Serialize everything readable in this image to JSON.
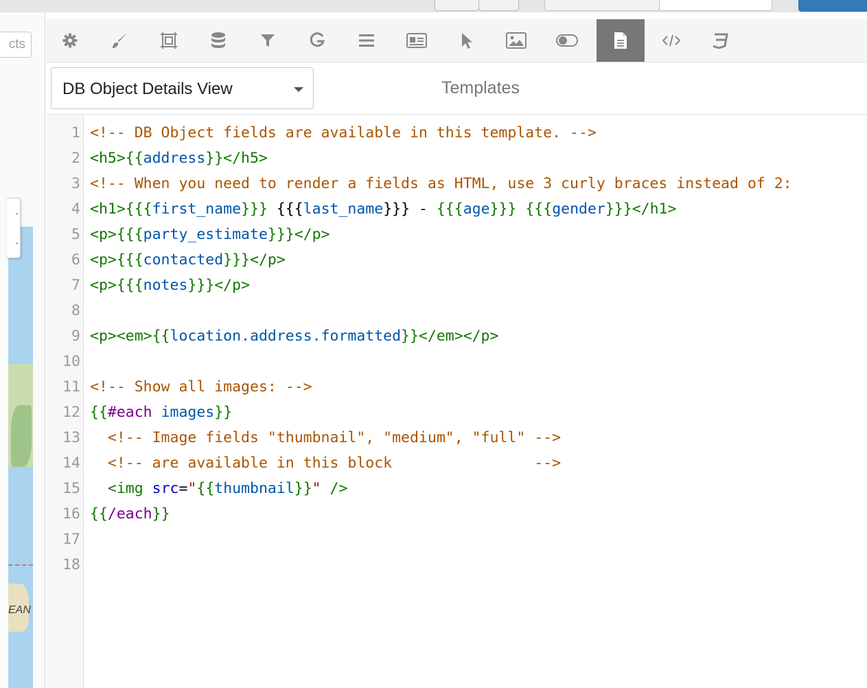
{
  "left_panel": {
    "objects_button_label": "cts",
    "map_ocean_label": "EAN",
    "zoom_in": "-",
    "zoom_out": "-"
  },
  "toolbar": {
    "icons": [
      "gear-icon",
      "brush-icon",
      "layout-icon",
      "database-icon",
      "filter-icon",
      "g-icon",
      "bars-icon",
      "card-icon",
      "cursor-icon",
      "image-icon",
      "toggle-icon",
      "template-icon",
      "code-icon",
      "css3-icon"
    ],
    "active": "template-icon"
  },
  "header": {
    "view_select_value": "DB Object Details View",
    "title": "Templates"
  },
  "editor": {
    "lines": [
      {
        "n": "1",
        "tokens": [
          {
            "t": "comment",
            "v": "<!-- DB Object fields are available in this template. -->"
          }
        ]
      },
      {
        "n": "2",
        "tokens": [
          {
            "t": "tag",
            "v": "<h5>{{"
          },
          {
            "t": "var",
            "v": "address"
          },
          {
            "t": "tag",
            "v": "}}</h5>"
          }
        ]
      },
      {
        "n": "3",
        "tokens": [
          {
            "t": "comment",
            "v": "<!-- When you need to render a fields as HTML, use 3 curly braces instead of 2:"
          }
        ]
      },
      {
        "n": "4",
        "tokens": [
          {
            "t": "tag",
            "v": "<h1>{{{"
          },
          {
            "t": "var",
            "v": "first_name"
          },
          {
            "t": "tag",
            "v": "}}}"
          },
          {
            "t": "plain",
            "v": " {{{"
          },
          {
            "t": "var",
            "v": "last_name"
          },
          {
            "t": "plain",
            "v": "}}} - "
          },
          {
            "t": "tag",
            "v": "{{{"
          },
          {
            "t": "var",
            "v": "age"
          },
          {
            "t": "tag",
            "v": "}}}"
          },
          {
            "t": "plain",
            "v": " "
          },
          {
            "t": "tag",
            "v": "{{{"
          },
          {
            "t": "var",
            "v": "gender"
          },
          {
            "t": "tag",
            "v": "}}}</h1>"
          }
        ]
      },
      {
        "n": "5",
        "tokens": [
          {
            "t": "tag",
            "v": "<p>{{{"
          },
          {
            "t": "var",
            "v": "party_estimate"
          },
          {
            "t": "tag",
            "v": "}}}</p>"
          }
        ]
      },
      {
        "n": "6",
        "tokens": [
          {
            "t": "tag",
            "v": "<p>{{{"
          },
          {
            "t": "var",
            "v": "contacted"
          },
          {
            "t": "tag",
            "v": "}}}</p>"
          }
        ]
      },
      {
        "n": "7",
        "tokens": [
          {
            "t": "tag",
            "v": "<p>{{{"
          },
          {
            "t": "var",
            "v": "notes"
          },
          {
            "t": "tag",
            "v": "}}}</p>"
          }
        ]
      },
      {
        "n": "8",
        "tokens": []
      },
      {
        "n": "9",
        "tokens": [
          {
            "t": "tag",
            "v": "<p><em>{{"
          },
          {
            "t": "var",
            "v": "location.address.formatted"
          },
          {
            "t": "tag",
            "v": "}}</em></p>"
          }
        ]
      },
      {
        "n": "10",
        "tokens": []
      },
      {
        "n": "11",
        "tokens": [
          {
            "t": "comment",
            "v": "<!-- Show all images: -->"
          }
        ]
      },
      {
        "n": "12",
        "tokens": [
          {
            "t": "tag",
            "v": "{{"
          },
          {
            "t": "kw",
            "v": "#each"
          },
          {
            "t": "plain",
            "v": " "
          },
          {
            "t": "var",
            "v": "images"
          },
          {
            "t": "tag",
            "v": "}}"
          }
        ]
      },
      {
        "n": "13",
        "tokens": [
          {
            "t": "plain",
            "v": "  "
          },
          {
            "t": "comment",
            "v": "<!-- Image fields \"thumbnail\", \"medium\", \"full\" -->"
          }
        ]
      },
      {
        "n": "14",
        "tokens": [
          {
            "t": "plain",
            "v": "  "
          },
          {
            "t": "comment",
            "v": "<!-- are available in this block                -->"
          }
        ]
      },
      {
        "n": "15",
        "tokens": [
          {
            "t": "plain",
            "v": "  "
          },
          {
            "t": "tag",
            "v": "<img"
          },
          {
            "t": "plain",
            "v": " "
          },
          {
            "t": "attr",
            "v": "src"
          },
          {
            "t": "plain",
            "v": "="
          },
          {
            "t": "str",
            "v": "\""
          },
          {
            "t": "tag",
            "v": "{{"
          },
          {
            "t": "var",
            "v": "thumbnail"
          },
          {
            "t": "tag",
            "v": "}}"
          },
          {
            "t": "str",
            "v": "\""
          },
          {
            "t": "tag",
            "v": " />"
          }
        ]
      },
      {
        "n": "16",
        "tokens": [
          {
            "t": "tag",
            "v": "{{"
          },
          {
            "t": "kw",
            "v": "/each"
          },
          {
            "t": "tag",
            "v": "}}"
          }
        ]
      },
      {
        "n": "17",
        "tokens": []
      },
      {
        "n": "18",
        "tokens": []
      }
    ]
  }
}
